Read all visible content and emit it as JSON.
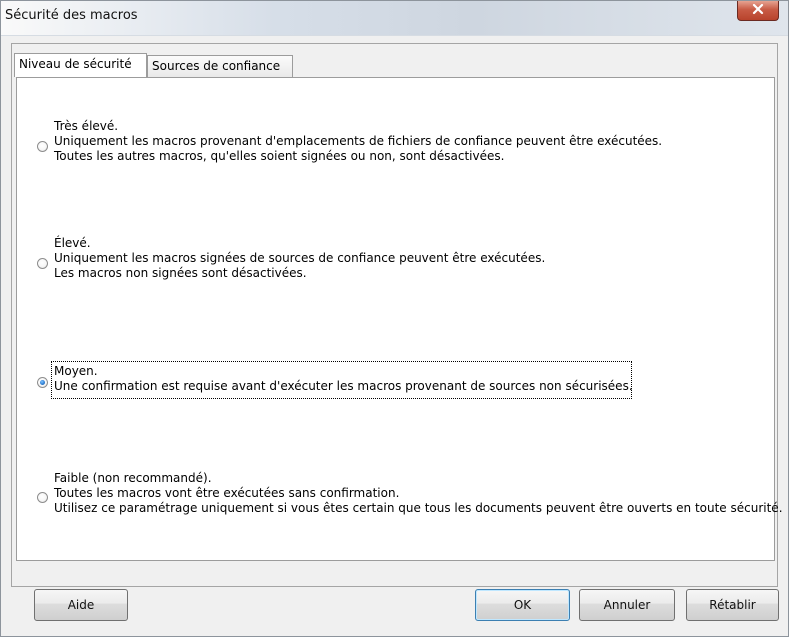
{
  "window": {
    "title": "Sécurité des macros"
  },
  "tabs": [
    {
      "label": "Niveau de sécurité",
      "active": true
    },
    {
      "label": "Sources de confiance",
      "active": false
    }
  ],
  "options": [
    {
      "title": "Très élevé.",
      "lines": [
        "Uniquement les macros provenant d'emplacements de fichiers de confiance peuvent être exécutées.",
        "Toutes les autres macros, qu'elles soient signées ou non, sont désactivées."
      ],
      "selected": false
    },
    {
      "title": "Élevé.",
      "lines": [
        "Uniquement les macros signées de sources de confiance peuvent être exécutées.",
        "Les macros non signées sont désactivées."
      ],
      "selected": false
    },
    {
      "title": "Moyen.",
      "lines": [
        "Une confirmation est requise avant d'exécuter les macros provenant de sources non sécurisées."
      ],
      "selected": true
    },
    {
      "title": "Faible (non recommandé).",
      "lines": [
        "Toutes les macros vont être exécutées sans confirmation.",
        "Utilisez ce paramétrage uniquement si vous êtes certain que tous les documents peuvent être ouverts en toute sécurité."
      ],
      "selected": false
    }
  ],
  "buttons": {
    "help": "Aide",
    "ok": "OK",
    "cancel": "Annuler",
    "reset": "Rétablir"
  },
  "icons": {
    "close": "close-icon"
  },
  "colors": {
    "close_button": "#c85b45",
    "selected_radio": "#2d7fd4"
  }
}
